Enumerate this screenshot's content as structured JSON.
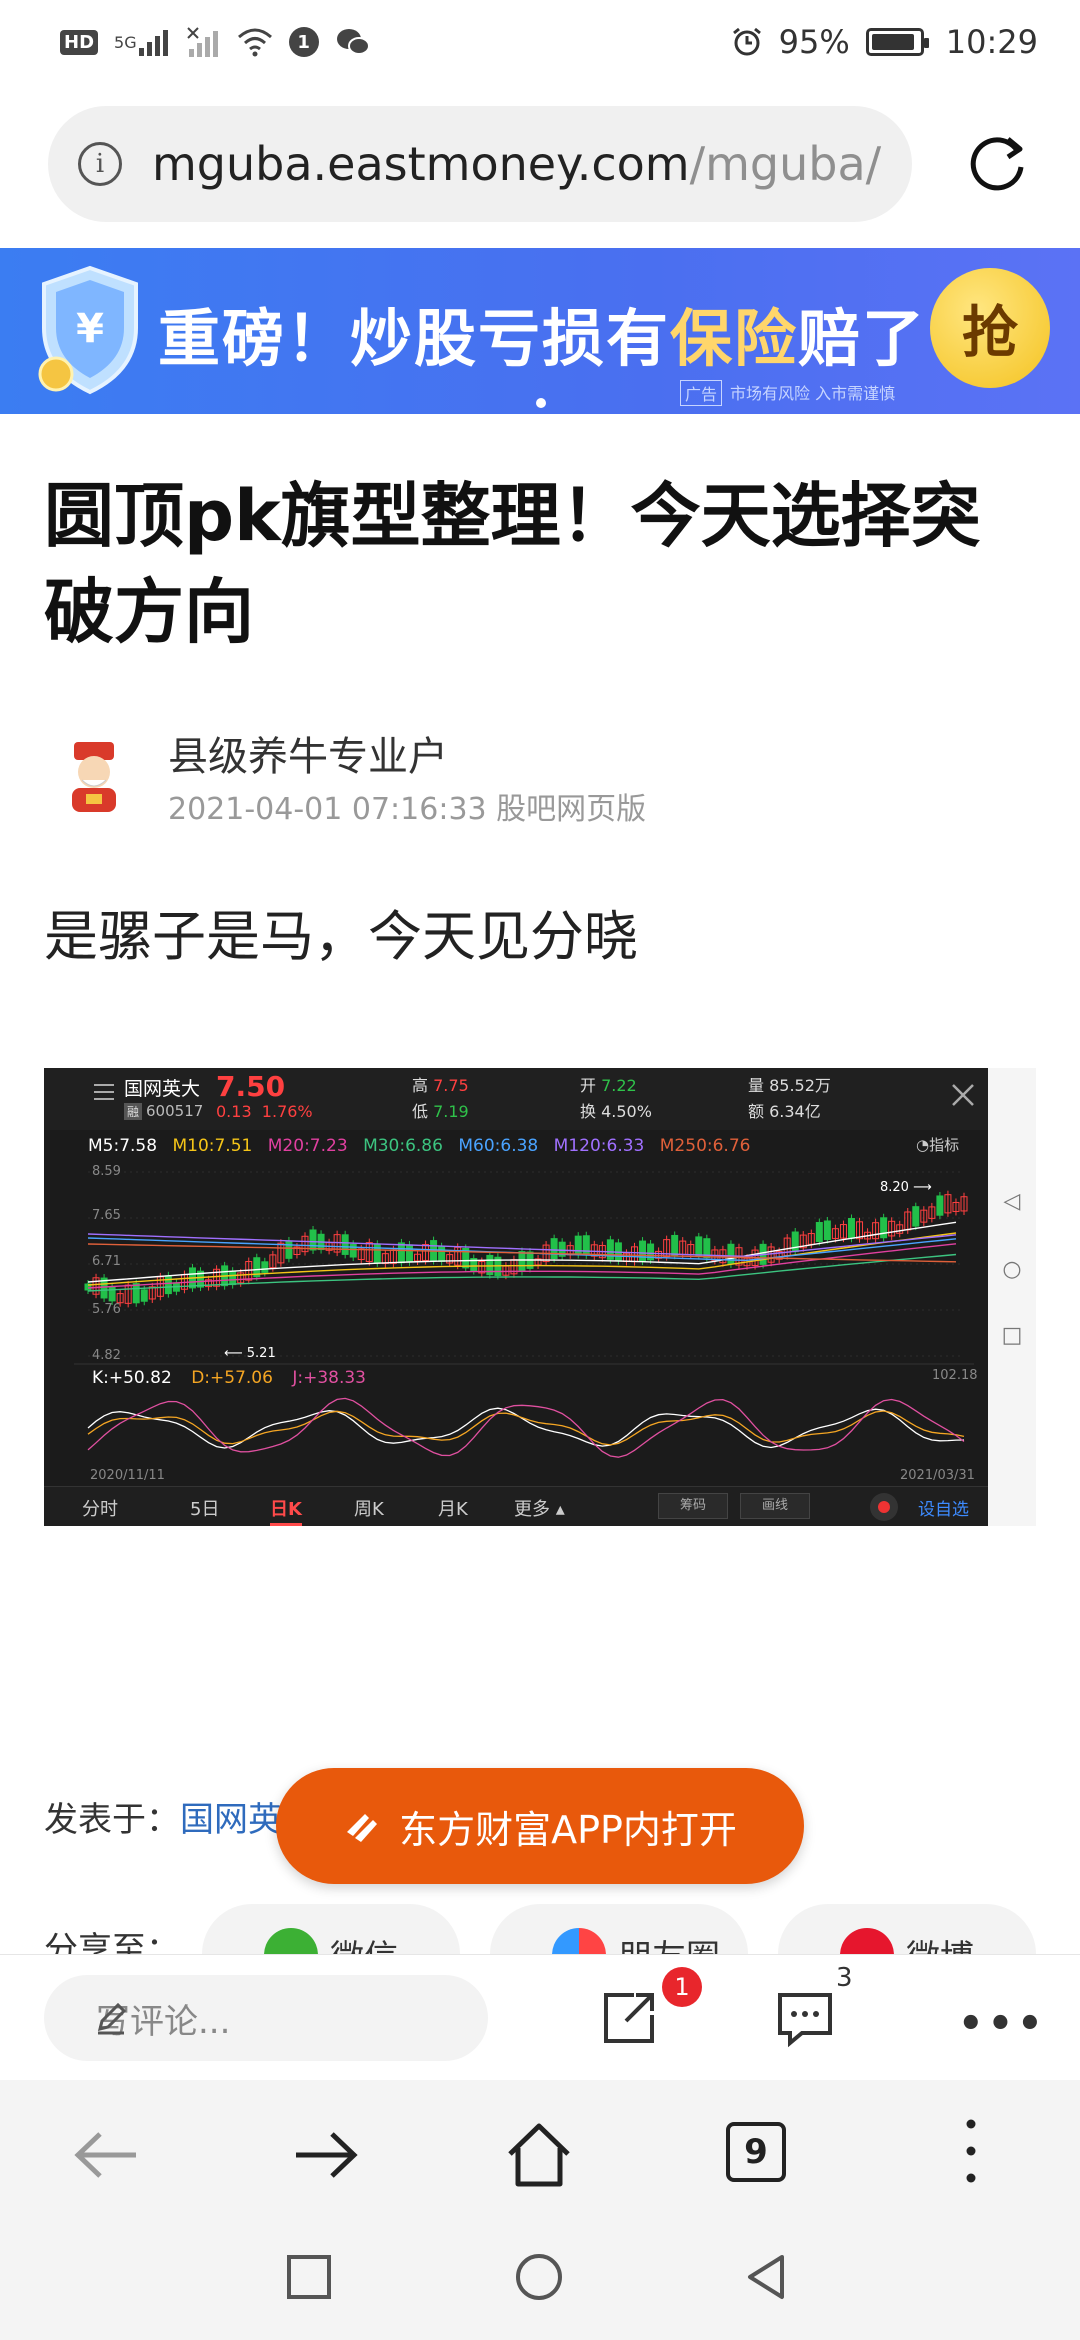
{
  "status_bar": {
    "network_badge": "HD",
    "network_type": "5G",
    "battery_percent": "95%",
    "time": "10:29",
    "icons": [
      "hd-icon",
      "signal-icon",
      "no-signal-icon",
      "wifi-icon",
      "notification-icon",
      "wechat-icon",
      "alarm-icon",
      "battery-icon"
    ]
  },
  "url_bar": {
    "host": "mguba.eastmoney.com",
    "path": "/mguba/ar"
  },
  "ad": {
    "text_prefix": "重磅！炒股亏损有",
    "text_highlight": "保险",
    "text_suffix": "赔了",
    "button": "抢",
    "tag": "广告",
    "disclaimer": "市场有风险  入市需谨慎",
    "colors": {
      "bg": "#4a6ff0",
      "highlight": "#ffd66b",
      "button": "#f4c21f"
    }
  },
  "article": {
    "title": "圆顶pk旗型整理！今天选择突破方向",
    "author": "县级养牛专业户",
    "meta": "2021-04-01 07:16:33 股吧网页版",
    "body": "是骡子是马，今天见分晓"
  },
  "stock_chart": {
    "name": "国网英大",
    "code": "600517",
    "price": "7.50",
    "change": "0.13",
    "change_pct": "1.76%",
    "high_label": "高",
    "high": "7.75",
    "low_label": "低",
    "low": "7.19",
    "open_label": "开",
    "open": "7.22",
    "turnover_label": "换",
    "turnover": "4.50%",
    "volume_label": "量",
    "volume": "85.52万",
    "amount_label": "额",
    "amount": "6.34亿",
    "indicator_label": "指标",
    "ma": [
      {
        "label": "M5:7.58",
        "color": "#ffffff"
      },
      {
        "label": "M10:7.51",
        "color": "#f5c518"
      },
      {
        "label": "M20:7.23",
        "color": "#e040a0"
      },
      {
        "label": "M30:6.86",
        "color": "#3cc480"
      },
      {
        "label": "M60:6.38",
        "color": "#4aa3ff"
      },
      {
        "label": "M120:6.33",
        "color": "#a070ff"
      },
      {
        "label": "M250:6.76",
        "color": "#e0603a"
      }
    ],
    "y_labels": [
      "8.59",
      "7.65",
      "6.71",
      "5.76",
      "4.82"
    ],
    "annotation_high": "8.20",
    "annotation_low": "5.21",
    "kdj": [
      {
        "label": "K:+50.82",
        "color": "#ffffff"
      },
      {
        "label": "D:+57.06",
        "color": "#f5a623"
      },
      {
        "label": "J:+38.33",
        "color": "#e050a0"
      }
    ],
    "kdj_max": "102.18",
    "date_start": "2020/11/11",
    "date_end": "2021/03/31",
    "tabs": [
      "分时",
      "5日",
      "日K",
      "周K",
      "月K",
      "更多"
    ],
    "active_tab": "日K",
    "tool_buttons": [
      "筹码",
      "画线"
    ],
    "add_watch": "设自选"
  },
  "posted": {
    "label": "发表于：",
    "link": "国网英"
  },
  "open_app": {
    "label": "东方财富APP内打开"
  },
  "share": {
    "label": "分享至：",
    "items": [
      "微信",
      "朋友圈",
      "微博"
    ]
  },
  "comment_bar": {
    "placeholder": "写评论...",
    "share_badge": "1",
    "comment_count": "3"
  },
  "browser_nav": {
    "tab_count": "9"
  }
}
